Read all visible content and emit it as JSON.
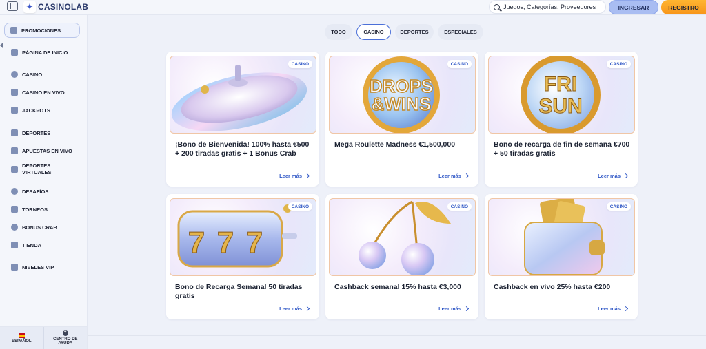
{
  "header": {
    "logo_text": "CASINOLAB",
    "search_placeholder": "Juegos, Categorías, Proveedores",
    "login_label": "INGRESAR",
    "register_label": "REGISTRO"
  },
  "sidebar": {
    "items": [
      {
        "label": "PROMOCIONES"
      },
      {
        "label": "PÁGINA DE INICIO"
      },
      {
        "label": "CASINO"
      },
      {
        "label": "CASINO EN VIVO"
      },
      {
        "label": "JACKPOTS"
      },
      {
        "label": "DEPORTES"
      },
      {
        "label": "APUESTAS EN VIVO"
      },
      {
        "label": "DEPORTES VIRTUALES"
      },
      {
        "label": "DESAFÍOS"
      },
      {
        "label": "TORNEOS"
      },
      {
        "label": "BONUS CRAB"
      },
      {
        "label": "TIENDA"
      },
      {
        "label": "NIVELES VIP"
      }
    ],
    "language_label": "ESPAÑOL",
    "help_label": "CENTRO DE AYUDA"
  },
  "tabs": [
    {
      "label": "TODO"
    },
    {
      "label": "CASINO"
    },
    {
      "label": "DEPORTES"
    },
    {
      "label": "ESPECIALES"
    }
  ],
  "cards": [
    {
      "badge": "CASINO",
      "title": "¡Bono de Bienvenida! 100% hasta €500 + 200 tiradas gratis + 1 Bonus Crab",
      "link": "Leer más"
    },
    {
      "badge": "CASINO",
      "title": "Mega Roulette Madness €1,500,000",
      "link": "Leer más",
      "art_text": [
        "DROPS",
        "&WINS"
      ]
    },
    {
      "badge": "CASINO",
      "title": "Bono de recarga de fin de semana €700 + 50 tiradas gratis",
      "link": "Leer más",
      "art_text": [
        "FRI",
        "SUN"
      ]
    },
    {
      "badge": "CASINO",
      "title": "Bono de Recarga Semanal 50 tiradas gratis",
      "link": "Leer más"
    },
    {
      "badge": "CASINO",
      "title": "Cashback semanal 15% hasta €3,000",
      "link": "Leer más"
    },
    {
      "badge": "CASINO",
      "title": "Cashback en vivo 25% hasta €200",
      "link": "Leer más"
    }
  ]
}
